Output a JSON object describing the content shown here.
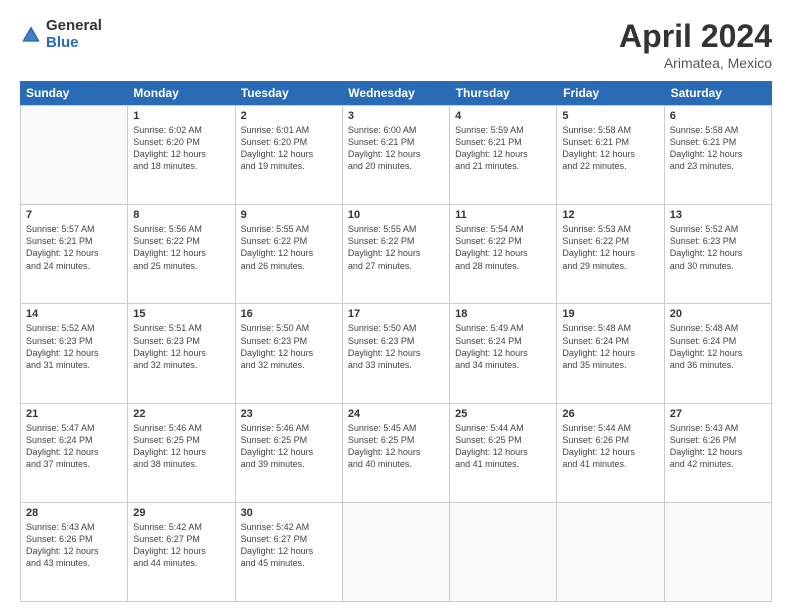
{
  "logo": {
    "general": "General",
    "blue": "Blue"
  },
  "title": {
    "month": "April 2024",
    "location": "Arimatea, Mexico"
  },
  "header": {
    "days": [
      "Sunday",
      "Monday",
      "Tuesday",
      "Wednesday",
      "Thursday",
      "Friday",
      "Saturday"
    ]
  },
  "weeks": [
    [
      {
        "day": "",
        "text": ""
      },
      {
        "day": "1",
        "text": "Sunrise: 6:02 AM\nSunset: 6:20 PM\nDaylight: 12 hours\nand 18 minutes."
      },
      {
        "day": "2",
        "text": "Sunrise: 6:01 AM\nSunset: 6:20 PM\nDaylight: 12 hours\nand 19 minutes."
      },
      {
        "day": "3",
        "text": "Sunrise: 6:00 AM\nSunset: 6:21 PM\nDaylight: 12 hours\nand 20 minutes."
      },
      {
        "day": "4",
        "text": "Sunrise: 5:59 AM\nSunset: 6:21 PM\nDaylight: 12 hours\nand 21 minutes."
      },
      {
        "day": "5",
        "text": "Sunrise: 5:58 AM\nSunset: 6:21 PM\nDaylight: 12 hours\nand 22 minutes."
      },
      {
        "day": "6",
        "text": "Sunrise: 5:58 AM\nSunset: 6:21 PM\nDaylight: 12 hours\nand 23 minutes."
      }
    ],
    [
      {
        "day": "7",
        "text": "Sunrise: 5:57 AM\nSunset: 6:21 PM\nDaylight: 12 hours\nand 24 minutes."
      },
      {
        "day": "8",
        "text": "Sunrise: 5:56 AM\nSunset: 6:22 PM\nDaylight: 12 hours\nand 25 minutes."
      },
      {
        "day": "9",
        "text": "Sunrise: 5:55 AM\nSunset: 6:22 PM\nDaylight: 12 hours\nand 26 minutes."
      },
      {
        "day": "10",
        "text": "Sunrise: 5:55 AM\nSunset: 6:22 PM\nDaylight: 12 hours\nand 27 minutes."
      },
      {
        "day": "11",
        "text": "Sunrise: 5:54 AM\nSunset: 6:22 PM\nDaylight: 12 hours\nand 28 minutes."
      },
      {
        "day": "12",
        "text": "Sunrise: 5:53 AM\nSunset: 6:22 PM\nDaylight: 12 hours\nand 29 minutes."
      },
      {
        "day": "13",
        "text": "Sunrise: 5:52 AM\nSunset: 6:23 PM\nDaylight: 12 hours\nand 30 minutes."
      }
    ],
    [
      {
        "day": "14",
        "text": "Sunrise: 5:52 AM\nSunset: 6:23 PM\nDaylight: 12 hours\nand 31 minutes."
      },
      {
        "day": "15",
        "text": "Sunrise: 5:51 AM\nSunset: 6:23 PM\nDaylight: 12 hours\nand 32 minutes."
      },
      {
        "day": "16",
        "text": "Sunrise: 5:50 AM\nSunset: 6:23 PM\nDaylight: 12 hours\nand 32 minutes."
      },
      {
        "day": "17",
        "text": "Sunrise: 5:50 AM\nSunset: 6:23 PM\nDaylight: 12 hours\nand 33 minutes."
      },
      {
        "day": "18",
        "text": "Sunrise: 5:49 AM\nSunset: 6:24 PM\nDaylight: 12 hours\nand 34 minutes."
      },
      {
        "day": "19",
        "text": "Sunrise: 5:48 AM\nSunset: 6:24 PM\nDaylight: 12 hours\nand 35 minutes."
      },
      {
        "day": "20",
        "text": "Sunrise: 5:48 AM\nSunset: 6:24 PM\nDaylight: 12 hours\nand 36 minutes."
      }
    ],
    [
      {
        "day": "21",
        "text": "Sunrise: 5:47 AM\nSunset: 6:24 PM\nDaylight: 12 hours\nand 37 minutes."
      },
      {
        "day": "22",
        "text": "Sunrise: 5:46 AM\nSunset: 6:25 PM\nDaylight: 12 hours\nand 38 minutes."
      },
      {
        "day": "23",
        "text": "Sunrise: 5:46 AM\nSunset: 6:25 PM\nDaylight: 12 hours\nand 39 minutes."
      },
      {
        "day": "24",
        "text": "Sunrise: 5:45 AM\nSunset: 6:25 PM\nDaylight: 12 hours\nand 40 minutes."
      },
      {
        "day": "25",
        "text": "Sunrise: 5:44 AM\nSunset: 6:25 PM\nDaylight: 12 hours\nand 41 minutes."
      },
      {
        "day": "26",
        "text": "Sunrise: 5:44 AM\nSunset: 6:26 PM\nDaylight: 12 hours\nand 41 minutes."
      },
      {
        "day": "27",
        "text": "Sunrise: 5:43 AM\nSunset: 6:26 PM\nDaylight: 12 hours\nand 42 minutes."
      }
    ],
    [
      {
        "day": "28",
        "text": "Sunrise: 5:43 AM\nSunset: 6:26 PM\nDaylight: 12 hours\nand 43 minutes."
      },
      {
        "day": "29",
        "text": "Sunrise: 5:42 AM\nSunset: 6:27 PM\nDaylight: 12 hours\nand 44 minutes."
      },
      {
        "day": "30",
        "text": "Sunrise: 5:42 AM\nSunset: 6:27 PM\nDaylight: 12 hours\nand 45 minutes."
      },
      {
        "day": "",
        "text": ""
      },
      {
        "day": "",
        "text": ""
      },
      {
        "day": "",
        "text": ""
      },
      {
        "day": "",
        "text": ""
      }
    ]
  ]
}
